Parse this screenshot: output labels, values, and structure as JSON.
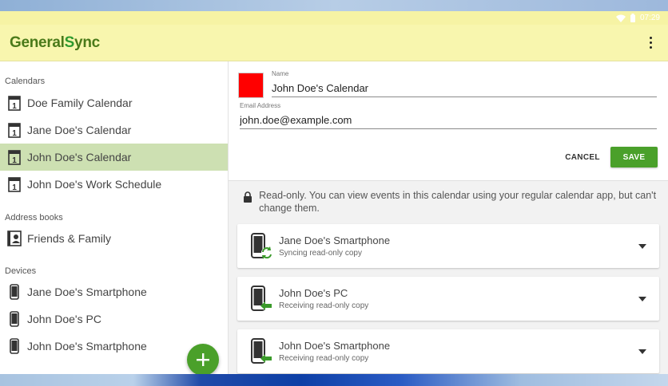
{
  "status_bar": {
    "time": "07:29"
  },
  "app": {
    "logo_general": "General",
    "logo_s": "S",
    "logo_ync": "ync"
  },
  "sidebar": {
    "calendars_title": "Calendars",
    "calendars": [
      {
        "label": "Doe Family Calendar"
      },
      {
        "label": "Jane Doe's Calendar"
      },
      {
        "label": "John Doe's Calendar",
        "selected": true
      },
      {
        "label": "John Doe's Work Schedule"
      }
    ],
    "address_books_title": "Address books",
    "address_books": [
      {
        "label": "Friends & Family"
      }
    ],
    "devices_title": "Devices",
    "devices": [
      {
        "label": "Jane Doe's Smartphone"
      },
      {
        "label": "John Doe's PC"
      },
      {
        "label": "John Doe's Smartphone"
      }
    ]
  },
  "detail": {
    "color": "#ff0000",
    "name_label": "Name",
    "name_value": "John Doe's Calendar",
    "email_label": "Email Address",
    "email_value": "john.doe@example.com",
    "cancel_label": "CANCEL",
    "save_label": "SAVE",
    "readonly_note": "Read-only. You can view events in this calendar using your regular calendar app, but can't change them.",
    "devices": [
      {
        "name": "Jane Doe's Smartphone",
        "status": "Syncing read-only copy",
        "icon": "phone-sync-icon"
      },
      {
        "name": "John Doe's PC",
        "status": "Receiving read-only copy",
        "icon": "phone-receive-icon"
      },
      {
        "name": "John Doe's Smartphone",
        "status": "Receiving read-only copy",
        "icon": "phone-receive-icon"
      }
    ]
  },
  "colors": {
    "accent": "#4aa02a",
    "toolbar": "#f8f6ae",
    "selected": "#cde0b2"
  }
}
